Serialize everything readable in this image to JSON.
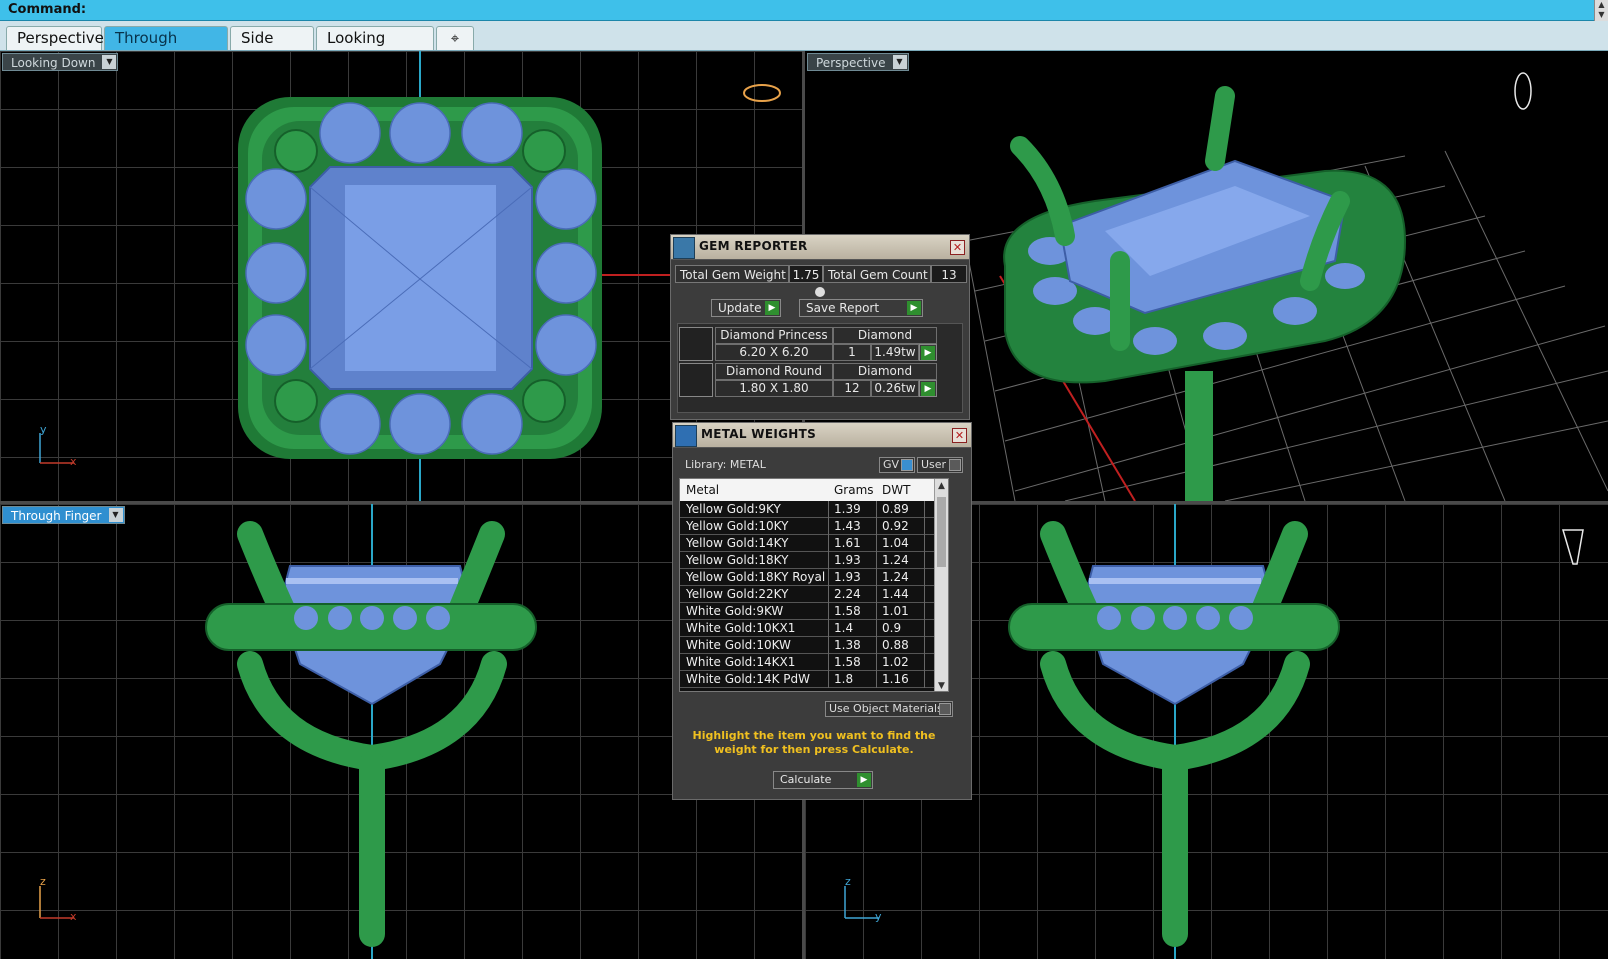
{
  "command_bar": {
    "label": "Command:"
  },
  "tabs": [
    {
      "label": "Perspective",
      "active": false
    },
    {
      "label": "Through Finger",
      "active": true
    },
    {
      "label": "Side View",
      "active": false
    },
    {
      "label": "Looking Down",
      "active": false
    }
  ],
  "tab_add_icon": "plus-icon",
  "viewports": {
    "top_left": {
      "label": "Looking Down",
      "axis_1": "y",
      "axis_2": "x"
    },
    "top_right": {
      "label": "Perspective"
    },
    "bottom_left": {
      "label": "Through Finger",
      "axis_1": "z",
      "axis_2": "x"
    },
    "bottom_right": {
      "axis_1": "z",
      "axis_2": "y"
    }
  },
  "gem_reporter": {
    "title": "GEM REPORTER",
    "total_weight_label": "Total Gem Weight",
    "total_weight_value": "1.75",
    "total_count_label": "Total Gem Count",
    "total_count_value": "13",
    "update_label": "Update",
    "save_report_label": "Save Report",
    "gems": [
      {
        "name": "Diamond Princess",
        "material": "Diamond",
        "size": "6.20 X 6.20",
        "count": "1",
        "weight": "1.49tw"
      },
      {
        "name": "Diamond Round",
        "material": "Diamond",
        "size": "1.80 X 1.80",
        "count": "12",
        "weight": "0.26tw"
      }
    ]
  },
  "metal_weights": {
    "title": "METAL WEIGHTS",
    "library_label": "Library: METAL",
    "gv_label": "GV",
    "user_label": "User",
    "columns": [
      "Metal",
      "Grams",
      "DWT"
    ],
    "rows": [
      [
        "Yellow Gold:9KY",
        "1.39",
        "0.89"
      ],
      [
        "Yellow Gold:10KY",
        "1.43",
        "0.92"
      ],
      [
        "Yellow Gold:14KY",
        "1.61",
        "1.04"
      ],
      [
        "Yellow Gold:18KY",
        "1.93",
        "1.24"
      ],
      [
        "Yellow Gold:18KY Royal",
        "1.93",
        "1.24"
      ],
      [
        "Yellow Gold:22KY",
        "2.24",
        "1.44"
      ],
      [
        "White Gold:9KW",
        "1.58",
        "1.01"
      ],
      [
        "White Gold:10KX1",
        "1.4",
        "0.9"
      ],
      [
        "White Gold:10KW",
        "1.38",
        "0.88"
      ],
      [
        "White Gold:14KX1",
        "1.58",
        "1.02"
      ],
      [
        "White Gold:14K PdW",
        "1.8",
        "1.16"
      ]
    ],
    "use_object_materials_label": "Use Object Materials",
    "hint": "Highlight the item you want to find the weight for then press Calculate.",
    "calculate_label": "Calculate"
  },
  "colors": {
    "metal": "#2e9a4a",
    "gem": "#6e93dc",
    "accent": "#41b6e6",
    "hint": "#f0c020"
  }
}
